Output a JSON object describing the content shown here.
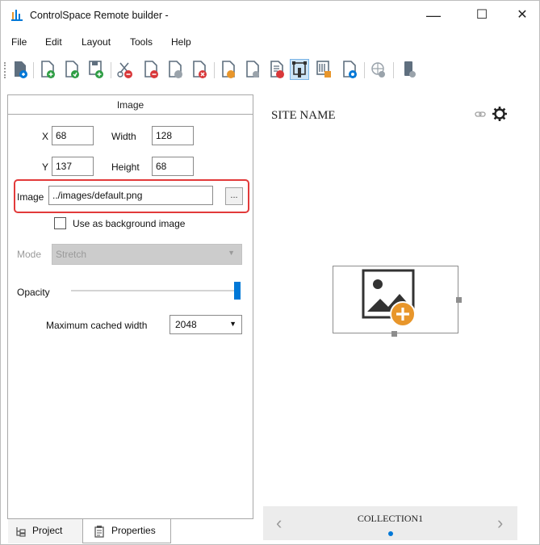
{
  "window": {
    "title": "ControlSpace Remote builder -",
    "minimize": "—",
    "maximize": "☐",
    "close": "✕"
  },
  "menu": [
    "File",
    "Edit",
    "Layout",
    "Tools",
    "Help"
  ],
  "toolbar_icons": [
    "open-project-icon",
    "new-page-icon",
    "open-page-icon",
    "save-page-icon",
    "cut-icon",
    "page-remove-icon",
    "page-delete-icon",
    "page-close-icon",
    "page-icon",
    "page-export-icon",
    "page-report-icon",
    "select-tool-icon",
    "keypad-icon",
    "page-settings-icon",
    "globe-icon",
    "device-icon"
  ],
  "properties": {
    "header": "Image",
    "x_label": "X",
    "x_value": "68",
    "width_label": "Width",
    "width_value": "128",
    "y_label": "Y",
    "y_value": "137",
    "height_label": "Height",
    "height_value": "68",
    "image_label": "Image",
    "image_value": "../images/default.png",
    "browse_label": "...",
    "bg_checkbox_label": "Use as background image",
    "bg_checked": false,
    "mode_label": "Mode",
    "mode_value": "Stretch",
    "opacity_label": "Opacity",
    "opacity_value": 1.0,
    "max_cached_label": "Maximum cached width",
    "max_cached_value": "2048"
  },
  "tabs": {
    "project": "Project",
    "properties": "Properties"
  },
  "preview": {
    "site_name": "SITE NAME",
    "collection": "COLLECTION1"
  },
  "colors": {
    "accent": "#0078d7",
    "highlight": "#e23a3a",
    "plus": "#e8962b"
  }
}
